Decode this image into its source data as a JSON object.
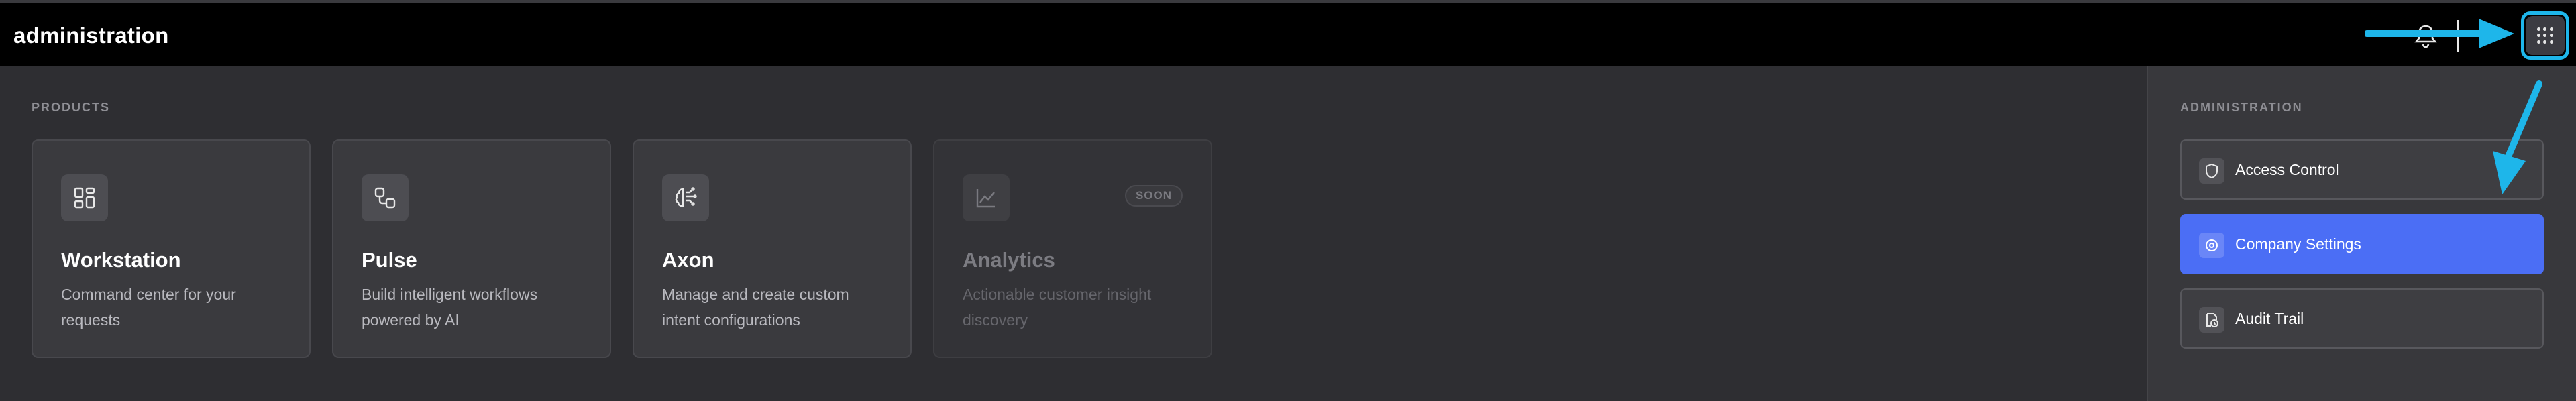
{
  "header": {
    "title": "administration",
    "icons": {
      "notifications": "bell-icon",
      "apps": "grid-icon"
    }
  },
  "products": {
    "label": "PRODUCTS",
    "cards": [
      {
        "name": "Workstation",
        "desc_line1": "Command center for your",
        "desc_line2": "requests",
        "icon": "dashboard-icon",
        "enabled": true
      },
      {
        "name": "Pulse",
        "desc_line1": "Build intelligent workflows",
        "desc_line2": "powered by AI",
        "icon": "workflow-icon",
        "enabled": true
      },
      {
        "name": "Axon",
        "desc_line1": "Manage and create custom",
        "desc_line2": "intent configurations",
        "icon": "brain-icon",
        "enabled": true
      },
      {
        "name": "Analytics",
        "desc_line1": "Actionable customer insight",
        "desc_line2": "discovery",
        "icon": "chart-icon",
        "enabled": false,
        "badge": "SOON"
      }
    ]
  },
  "administration": {
    "label": "ADMINISTRATION",
    "items": [
      {
        "label": "Access Control",
        "icon": "shield-icon",
        "active": false
      },
      {
        "label": "Company Settings",
        "icon": "settings-icon",
        "active": true
      },
      {
        "label": "Audit Trail",
        "icon": "history-icon",
        "active": false
      }
    ]
  },
  "colors": {
    "accent": "#4b6ef5",
    "annotation": "#1eb6ea",
    "header_bg": "#000000",
    "page_bg": "#2e2e32"
  }
}
